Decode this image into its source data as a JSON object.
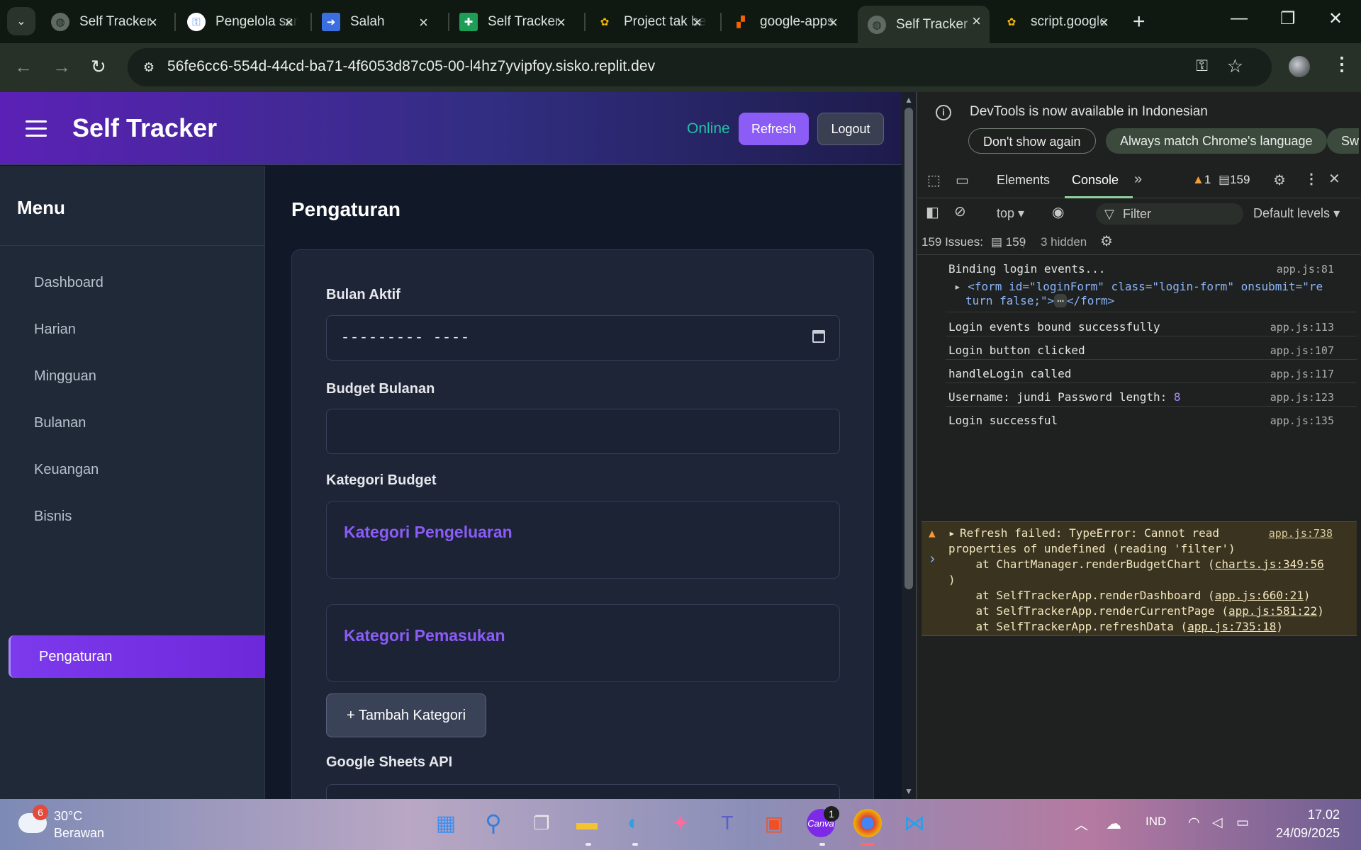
{
  "browser": {
    "tabs": [
      {
        "label": "Self Tracker",
        "icon": "globe-icon"
      },
      {
        "label": "Pengelola sandi",
        "icon": "google-key-icon"
      },
      {
        "label": "Salah",
        "icon": "arrow-right-icon"
      },
      {
        "label": "Self Tracker",
        "icon": "sheets-icon"
      },
      {
        "label": "Project tak berjudul",
        "icon": "apps-script-icon"
      },
      {
        "label": "google-apps",
        "icon": "replit-icon"
      },
      {
        "label": "Self Tracker",
        "icon": "globe-icon"
      },
      {
        "label": "script.google",
        "icon": "apps-script-icon"
      }
    ],
    "active_tab_index": 6,
    "url": "56fe6cc6-554d-44cd-ba71-4f6053d87c05-00-l4hz7yvipfoy.sisko.replit.dev"
  },
  "app": {
    "title": "Self Tracker",
    "status": "Online",
    "refresh_label": "Refresh",
    "logout_label": "Logout",
    "menu_title": "Menu",
    "menu": [
      "Dashboard",
      "Harian",
      "Mingguan",
      "Bulanan",
      "Keuangan",
      "Bisnis",
      "Pengaturan"
    ],
    "active_menu": "Pengaturan",
    "page_title": "Pengaturan",
    "settings": {
      "bulan_aktif_label": "Bulan Aktif",
      "bulan_aktif_value": "--------- ----",
      "budget_label": "Budget Bulanan",
      "budget_value": "",
      "kategori_label": "Kategori Budget",
      "kategori_pengeluaran": "Kategori Pengeluaran",
      "kategori_pemasukan": "Kategori Pemasukan",
      "add_category_label": "+ Tambah Kategori",
      "sheets_label": "Google Sheets API"
    },
    "colors": {
      "accent": "#8b5cf6",
      "online": "#22c1a0"
    }
  },
  "devtools": {
    "banner": "DevTools is now available in Indonesian",
    "dont_show": "Don't show again",
    "always_match": "Always match Chrome's language",
    "switch_cut": "Sw",
    "tabs": [
      "Elements",
      "Console"
    ],
    "active_tab": "Console",
    "warnings_count": "1",
    "messages_count": "159",
    "context": "top",
    "filter_placeholder": "Filter",
    "levels": "Default levels",
    "issues_label": "159 Issues:",
    "issues_count": "159",
    "hidden": "3 hidden",
    "logs": [
      {
        "text": "Binding login events...",
        "src": "app.js:81"
      },
      {
        "text": "Login events bound successfully",
        "src": "app.js:113"
      },
      {
        "text": "Login button clicked",
        "src": "app.js:107"
      },
      {
        "text": "handleLogin called",
        "src": "app.js:117"
      },
      {
        "text": "Username: jundi Password length: ",
        "value": "8",
        "src": "app.js:123"
      },
      {
        "text": "Login successful",
        "src": "app.js:135"
      }
    ],
    "form_line_1": "<form id=\"loginForm\" class=\"login-form\" onsubmit=\"re",
    "form_line_2": "turn false;\">",
    "form_end": "</form>",
    "error": {
      "line1": "Refresh failed: TypeError: Cannot read",
      "src": "app.js:738",
      "line2": "properties of undefined (reading 'filter')",
      "line3": "    at ChartManager.renderBudgetChart (",
      "line3_link": "charts.js:349:56",
      "line4": ")",
      "line5": "    at SelfTrackerApp.renderDashboard (",
      "line5_link": "app.js:660:21",
      "line6": "    at SelfTrackerApp.renderCurrentPage (",
      "line6_link": "app.js:581:22",
      "line7": "    at SelfTrackerApp.refreshData (",
      "line7_link": "app.js:735:18"
    }
  },
  "taskbar": {
    "weather_temp": "30°C",
    "weather_desc": "Berawan",
    "weather_badge": "6",
    "canva_badge": "1",
    "language": "IND",
    "time": "17.02",
    "date": "24/09/2025"
  }
}
